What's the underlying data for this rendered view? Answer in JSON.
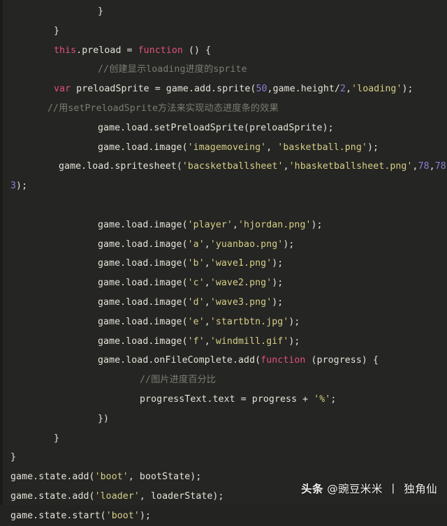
{
  "editor": {
    "background_color": "#252523",
    "default_text_color": "#e6e3da",
    "keyword_color": "#e0527a",
    "string_color": "#d6cf87",
    "number_color": "#8b7fd4",
    "comment_color": "#7c7c74",
    "language": "JavaScript"
  },
  "code_lines": [
    {
      "indent": 140,
      "tokens": [
        {
          "t": "}",
          "c": "pl"
        }
      ]
    },
    {
      "indent": 77,
      "tokens": [
        {
          "t": "}",
          "c": "pl"
        }
      ]
    },
    {
      "indent": 77,
      "tokens": [
        {
          "t": "this",
          "c": "kw"
        },
        {
          "t": ".preload = ",
          "c": "pl"
        },
        {
          "t": "function",
          "c": "kw"
        },
        {
          "t": " () {",
          "c": "pl"
        }
      ]
    },
    {
      "indent": 140,
      "tokens": [
        {
          "t": "//创建显示loading进度的sprite",
          "c": "cmt"
        }
      ]
    },
    {
      "indent": 77,
      "tokens": [
        {
          "t": "var",
          "c": "kw"
        },
        {
          "t": " preloadSprite = game.add.sprite(",
          "c": "pl"
        },
        {
          "t": "50",
          "c": "num"
        },
        {
          "t": ",game.height/",
          "c": "pl"
        },
        {
          "t": "2",
          "c": "num"
        },
        {
          "t": ",",
          "c": "pl"
        },
        {
          "t": "'loading'",
          "c": "str"
        },
        {
          "t": ");",
          "c": "pl"
        }
      ]
    },
    {
      "indent": 68,
      "tokens": [
        {
          "t": "//用setPreloadSprite方法来实现动态进度条的效果",
          "c": "cmt"
        }
      ]
    },
    {
      "indent": 140,
      "tokens": [
        {
          "t": "game.load.setPreloadSprite(preloadSprite);",
          "c": "pl"
        }
      ]
    },
    {
      "indent": 140,
      "tokens": [
        {
          "t": "game.load.image(",
          "c": "pl"
        },
        {
          "t": "'imagemoveing'",
          "c": "str"
        },
        {
          "t": ", ",
          "c": "pl"
        },
        {
          "t": "'basketball.png'",
          "c": "str"
        },
        {
          "t": ");",
          "c": "pl"
        }
      ]
    },
    {
      "indent": 84,
      "tokens": [
        {
          "t": "game.load.spritesheet(",
          "c": "pl"
        },
        {
          "t": "'bacsketballsheet'",
          "c": "str"
        },
        {
          "t": ",",
          "c": "pl"
        },
        {
          "t": "'hbasketballsheet.png'",
          "c": "str"
        },
        {
          "t": ",",
          "c": "pl"
        },
        {
          "t": "78",
          "c": "num"
        },
        {
          "t": ",",
          "c": "pl"
        },
        {
          "t": "78",
          "c": "num"
        },
        {
          "t": ",",
          "c": "pl"
        }
      ]
    },
    {
      "indent": 15,
      "tokens": [
        {
          "t": "3",
          "c": "num"
        },
        {
          "t": ");",
          "c": "pl"
        }
      ]
    },
    {
      "indent": 0,
      "tokens": [
        {
          "t": "",
          "c": "pl"
        }
      ]
    },
    {
      "indent": 140,
      "tokens": [
        {
          "t": "game.load.image(",
          "c": "pl"
        },
        {
          "t": "'player'",
          "c": "str"
        },
        {
          "t": ",",
          "c": "pl"
        },
        {
          "t": "'hjordan.png'",
          "c": "str"
        },
        {
          "t": ");",
          "c": "pl"
        }
      ]
    },
    {
      "indent": 140,
      "tokens": [
        {
          "t": "game.load.image(",
          "c": "pl"
        },
        {
          "t": "'a'",
          "c": "str"
        },
        {
          "t": ",",
          "c": "pl"
        },
        {
          "t": "'yuanbao.png'",
          "c": "str"
        },
        {
          "t": ");",
          "c": "pl"
        }
      ]
    },
    {
      "indent": 140,
      "tokens": [
        {
          "t": "game.load.image(",
          "c": "pl"
        },
        {
          "t": "'b'",
          "c": "str"
        },
        {
          "t": ",",
          "c": "pl"
        },
        {
          "t": "'wave1.png'",
          "c": "str"
        },
        {
          "t": ");",
          "c": "pl"
        }
      ]
    },
    {
      "indent": 140,
      "tokens": [
        {
          "t": "game.load.image(",
          "c": "pl"
        },
        {
          "t": "'c'",
          "c": "str"
        },
        {
          "t": ",",
          "c": "pl"
        },
        {
          "t": "'wave2.png'",
          "c": "str"
        },
        {
          "t": ");",
          "c": "pl"
        }
      ]
    },
    {
      "indent": 140,
      "tokens": [
        {
          "t": "game.load.image(",
          "c": "pl"
        },
        {
          "t": "'d'",
          "c": "str"
        },
        {
          "t": ",",
          "c": "pl"
        },
        {
          "t": "'wave3.png'",
          "c": "str"
        },
        {
          "t": ");",
          "c": "pl"
        }
      ]
    },
    {
      "indent": 140,
      "tokens": [
        {
          "t": "game.load.image(",
          "c": "pl"
        },
        {
          "t": "'e'",
          "c": "str"
        },
        {
          "t": ",",
          "c": "pl"
        },
        {
          "t": "'startbtn.jpg'",
          "c": "str"
        },
        {
          "t": ");",
          "c": "pl"
        }
      ]
    },
    {
      "indent": 140,
      "tokens": [
        {
          "t": "game.load.image(",
          "c": "pl"
        },
        {
          "t": "'f'",
          "c": "str"
        },
        {
          "t": ",",
          "c": "pl"
        },
        {
          "t": "'windmill.gif'",
          "c": "str"
        },
        {
          "t": ");",
          "c": "pl"
        }
      ]
    },
    {
      "indent": 140,
      "tokens": [
        {
          "t": "game.load.onFileComplete.add(",
          "c": "pl"
        },
        {
          "t": "function",
          "c": "kw"
        },
        {
          "t": " (progress) {",
          "c": "pl"
        }
      ]
    },
    {
      "indent": 200,
      "tokens": [
        {
          "t": "//图片进度百分比",
          "c": "cmt"
        }
      ]
    },
    {
      "indent": 200,
      "tokens": [
        {
          "t": "progressText.text = progress + ",
          "c": "pl"
        },
        {
          "t": "'%'",
          "c": "str"
        },
        {
          "t": ";",
          "c": "pl"
        }
      ]
    },
    {
      "indent": 140,
      "tokens": [
        {
          "t": "})",
          "c": "pl"
        }
      ]
    },
    {
      "indent": 77,
      "tokens": [
        {
          "t": "}",
          "c": "pl"
        }
      ]
    },
    {
      "indent": 15,
      "tokens": [
        {
          "t": "}",
          "c": "pl"
        }
      ]
    },
    {
      "indent": 15,
      "tokens": [
        {
          "t": "game.state.add(",
          "c": "pl"
        },
        {
          "t": "'boot'",
          "c": "str"
        },
        {
          "t": ", bootState);",
          "c": "pl"
        }
      ]
    },
    {
      "indent": 15,
      "tokens": [
        {
          "t": "game.state.add(",
          "c": "pl"
        },
        {
          "t": "'loader'",
          "c": "str"
        },
        {
          "t": ", loaderState);",
          "c": "pl"
        }
      ]
    },
    {
      "indent": 15,
      "tokens": [
        {
          "t": "game.state.start(",
          "c": "pl"
        },
        {
          "t": "'boot'",
          "c": "str"
        },
        {
          "t": ");",
          "c": "pl"
        }
      ]
    }
  ],
  "watermark": {
    "brand": "头条",
    "handle": "@豌豆米米",
    "separator": "丨",
    "author": "独角仙"
  }
}
